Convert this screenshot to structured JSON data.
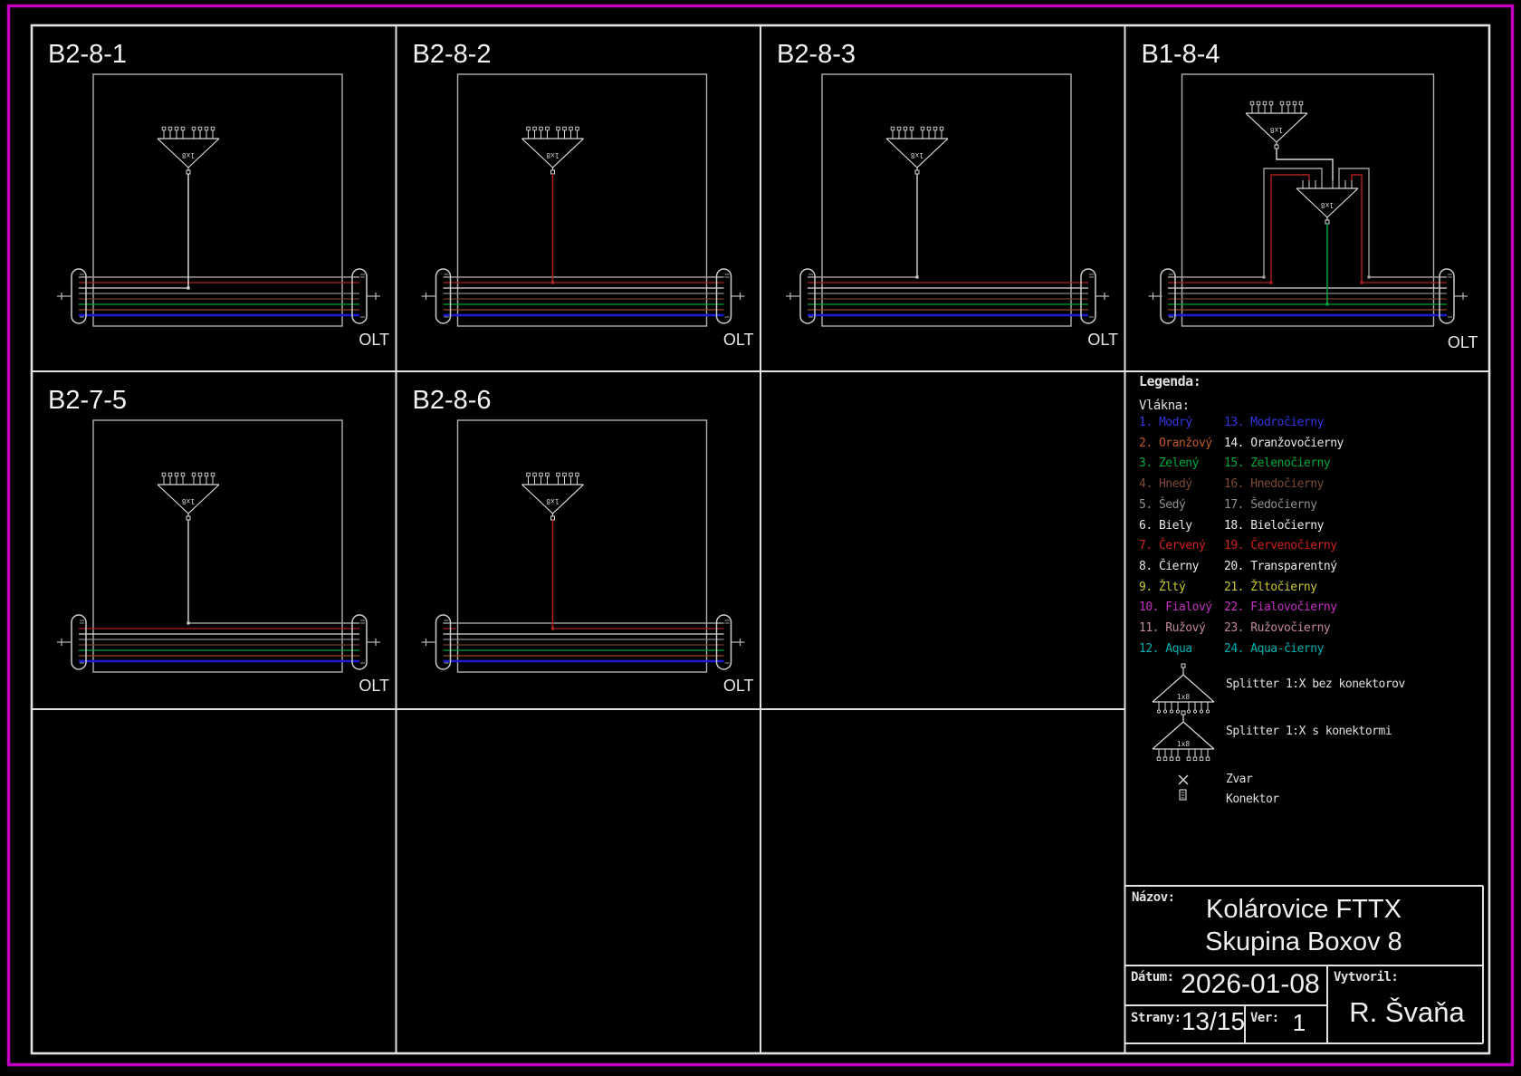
{
  "page": {
    "background": "#000000",
    "border_color": "#c400c4",
    "frame_color": "#e2e2e2",
    "box_color": "#b0b0b0",
    "symbol_color": "#d8d8d8"
  },
  "panels": [
    {
      "id": "b2-8-1",
      "label": "B2-8-1",
      "olt_label": "OLT",
      "col": 0,
      "row": 0,
      "type": "single",
      "splitter_label": "1x8",
      "splitter_connectors": true,
      "tap": {
        "fiber": 6,
        "bundle_index": 2,
        "side": "left",
        "drop_color": "#d8d8d8"
      }
    },
    {
      "id": "b2-8-2",
      "label": "B2-8-2",
      "olt_label": "OLT",
      "col": 1,
      "row": 0,
      "type": "single",
      "splitter_label": "1x8",
      "splitter_connectors": true,
      "tap": {
        "fiber": 7,
        "bundle_index": 1,
        "side": "full",
        "drop_color": "#b42424"
      }
    },
    {
      "id": "b2-8-3",
      "label": "B2-8-3",
      "olt_label": "OLT",
      "col": 2,
      "row": 0,
      "type": "single",
      "splitter_label": "1x8",
      "splitter_connectors": true,
      "tap": {
        "fiber": 8,
        "bundle_index": 0,
        "side": "left",
        "drop_color": "#c8c8c8"
      }
    },
    {
      "id": "b1-8-4",
      "label": "B1-8-4",
      "olt_label": "OLT",
      "col": 3,
      "row": 0,
      "type": "double",
      "splitter_label": "1x8",
      "splitter2_label": "1x8",
      "tap": {
        "fiber": 3,
        "bundle_index": 5,
        "drop_color": "#00a33e"
      },
      "riser_bundle_indices": [
        0,
        1
      ]
    },
    {
      "id": "b2-7-5",
      "label": "B2-7-5",
      "olt_label": "OLT",
      "col": 0,
      "row": 1,
      "type": "single",
      "splitter_label": "1x8",
      "splitter_connectors": true,
      "tap": {
        "fiber": 8,
        "bundle_index": 0,
        "side": "right",
        "drop_color": "#c8c8c8"
      }
    },
    {
      "id": "b2-8-6",
      "label": "B2-8-6",
      "olt_label": "OLT",
      "col": 1,
      "row": 1,
      "type": "single",
      "splitter_label": "1x8",
      "splitter_connectors": true,
      "tap": {
        "fiber": 7,
        "bundle_index": 1,
        "side": "right",
        "left_stub": true,
        "drop_color": "#b42424"
      }
    }
  ],
  "bundle": {
    "fibers_top_to_bottom": [
      {
        "fiber": 8,
        "name": "Čierny",
        "color": "#9c9c9c"
      },
      {
        "fiber": 7,
        "name": "Červený",
        "color": "#aa2020"
      },
      {
        "fiber": 6,
        "name": "Biely",
        "color": "#d8d8d8"
      },
      {
        "fiber": 5,
        "name": "Šedý",
        "color": "#8a8a8a"
      },
      {
        "fiber": 4,
        "name": "Hnedý",
        "color": "#6e4030"
      },
      {
        "fiber": 3,
        "name": "Zelený",
        "color": "#00a33e"
      },
      {
        "fiber": 2,
        "name": "Oranžový",
        "color": "#9a4e1c"
      },
      {
        "fiber": 1,
        "name": "Modrý",
        "color": "#1c1cd8"
      }
    ]
  },
  "legend": {
    "title": "Legenda:",
    "subtitle": "Vlákna:",
    "splitter_symbol_label": "1x8",
    "fibers": [
      {
        "label": "1. Modrý",
        "color": "#3535dd"
      },
      {
        "label": "2. Oranžový",
        "color": "#c05a28"
      },
      {
        "label": "3. Zelený",
        "color": "#00a83e"
      },
      {
        "label": "4. Hnedý",
        "color": "#7d4a38"
      },
      {
        "label": "5. Šedý",
        "color": "#909090"
      },
      {
        "label": "6. Biely",
        "color": "#e8e8e8"
      },
      {
        "label": "7. Červený",
        "color": "#cc2222"
      },
      {
        "label": "8. Čierny",
        "color": "#e8e8e8"
      },
      {
        "label": "9. Žltý",
        "color": "#c8c832"
      },
      {
        "label": "10. Fialový",
        "color": "#c032c0"
      },
      {
        "label": "11. Ružový",
        "color": "#c08898"
      },
      {
        "label": "12. Aqua",
        "color": "#00b0b0"
      },
      {
        "label": "13. Modročierny",
        "color": "#3535dd"
      },
      {
        "label": "14. Oranžovočierny",
        "color": "#e8e8e8"
      },
      {
        "label": "15. Zelenočierny",
        "color": "#00a83e"
      },
      {
        "label": "16. Hnedočierny",
        "color": "#7d4a38"
      },
      {
        "label": "17. Šedočierny",
        "color": "#909090"
      },
      {
        "label": "18. Bieločierny",
        "color": "#e8e8e8"
      },
      {
        "label": "19. Červenočierny",
        "color": "#cc2222"
      },
      {
        "label": "20. Transparentný",
        "color": "#e8e8e8"
      },
      {
        "label": "21. Žltočierny",
        "color": "#c8c832"
      },
      {
        "label": "22. Fialovočierny",
        "color": "#c032c0"
      },
      {
        "label": "23. Ružovočierny",
        "color": "#c08898"
      },
      {
        "label": "24. Aqua-čierny",
        "color": "#00b0b0"
      }
    ],
    "symbols": [
      {
        "type": "splitter-no-connectors",
        "label": "Splitter 1:X bez konektorov"
      },
      {
        "type": "splitter-with-connectors",
        "label": "Splitter 1:X s konektormi"
      },
      {
        "type": "zvar",
        "label": "Zvar"
      },
      {
        "type": "konektor",
        "label": "Konektor"
      }
    ]
  },
  "title_block": {
    "nazov_label": "Názov:",
    "title_line1": "Kolárovice FTTX",
    "title_line2": "Skupina Boxov 8",
    "datum_label": "Dátum:",
    "datum_value": "2026-01-08",
    "vytvoril_label": "Vytvoril:",
    "vytvoril_value": "R. Švaňa",
    "strany_label": "Strany:",
    "strany_value": "13/15",
    "ver_label": "Ver:",
    "ver_value": "1"
  }
}
